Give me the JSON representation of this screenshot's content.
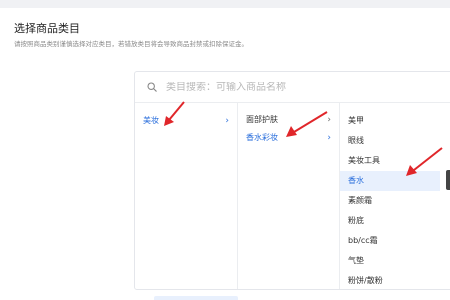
{
  "header": {
    "title": "选择商品类目",
    "description": "请按照商品类别谨慎选择对应类目，若错放类目将会导致商品封禁或扣除保证金。"
  },
  "search": {
    "placeholder": "类目搜索：可输入商品名称"
  },
  "level1": [
    {
      "label": "美妆",
      "active": true
    }
  ],
  "level2": [
    {
      "label": "面部护肤",
      "active": false
    },
    {
      "label": "香水彩妆",
      "active": true
    }
  ],
  "level3": [
    {
      "label": "美甲",
      "selected": false
    },
    {
      "label": "眼线",
      "selected": false
    },
    {
      "label": "美妆工具",
      "selected": false
    },
    {
      "label": "香水",
      "selected": true
    },
    {
      "label": "素颜霜",
      "selected": false
    },
    {
      "label": "粉底",
      "selected": false
    },
    {
      "label": "bb/cc霜",
      "selected": false
    },
    {
      "label": "气垫",
      "selected": false
    },
    {
      "label": "粉饼/散粉",
      "selected": false
    }
  ],
  "colors": {
    "accent": "#2b6fdc",
    "selected_bg": "#e8f0fd",
    "annotation_arrow": "#e0262a"
  },
  "icons": {
    "search": "search-icon",
    "chevron": "chevron-right-icon",
    "annotation": "red-arrow-annotation"
  }
}
